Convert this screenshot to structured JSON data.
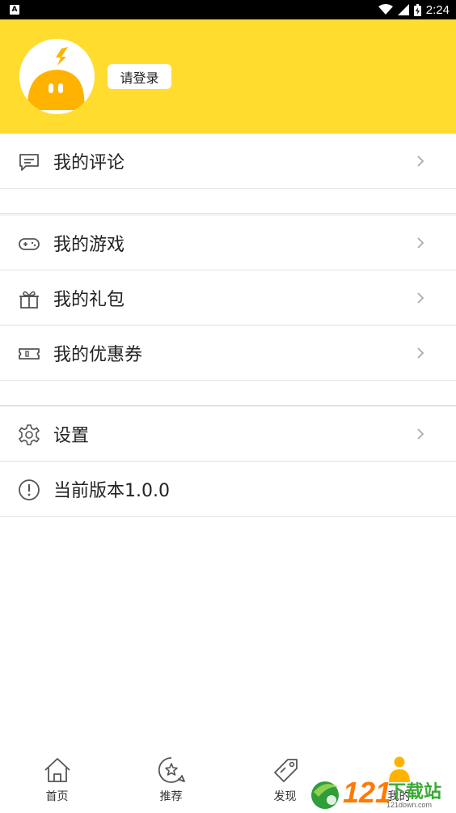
{
  "status_bar": {
    "time": "2:24",
    "left_badge": "A"
  },
  "header": {
    "login_label": "请登录",
    "bg_color": "#ffdc2e"
  },
  "menu_groups": [
    [
      {
        "icon": "comment-icon",
        "label": "我的评论",
        "chevron": true
      }
    ],
    [
      {
        "icon": "gamepad-icon",
        "label": "我的游戏",
        "chevron": true
      },
      {
        "icon": "gift-icon",
        "label": "我的礼包",
        "chevron": true
      },
      {
        "icon": "coupon-icon",
        "label": "我的优惠券",
        "chevron": true
      }
    ],
    [
      {
        "icon": "gear-icon",
        "label": "设置",
        "chevron": true
      },
      {
        "icon": "info-icon",
        "label": "当前版本1.0.0",
        "chevron": false
      }
    ]
  ],
  "tabbar": {
    "tabs": [
      {
        "icon": "home-icon",
        "label": "首页"
      },
      {
        "icon": "star-chat-icon",
        "label": "推荐"
      },
      {
        "icon": "tag-icon",
        "label": "发现"
      },
      {
        "icon": "person-icon",
        "label": "我的",
        "active": true
      }
    ],
    "active_color": "#ffb300"
  },
  "watermark": {
    "number": "121",
    "text": "下载站",
    "url": "121down.com"
  }
}
